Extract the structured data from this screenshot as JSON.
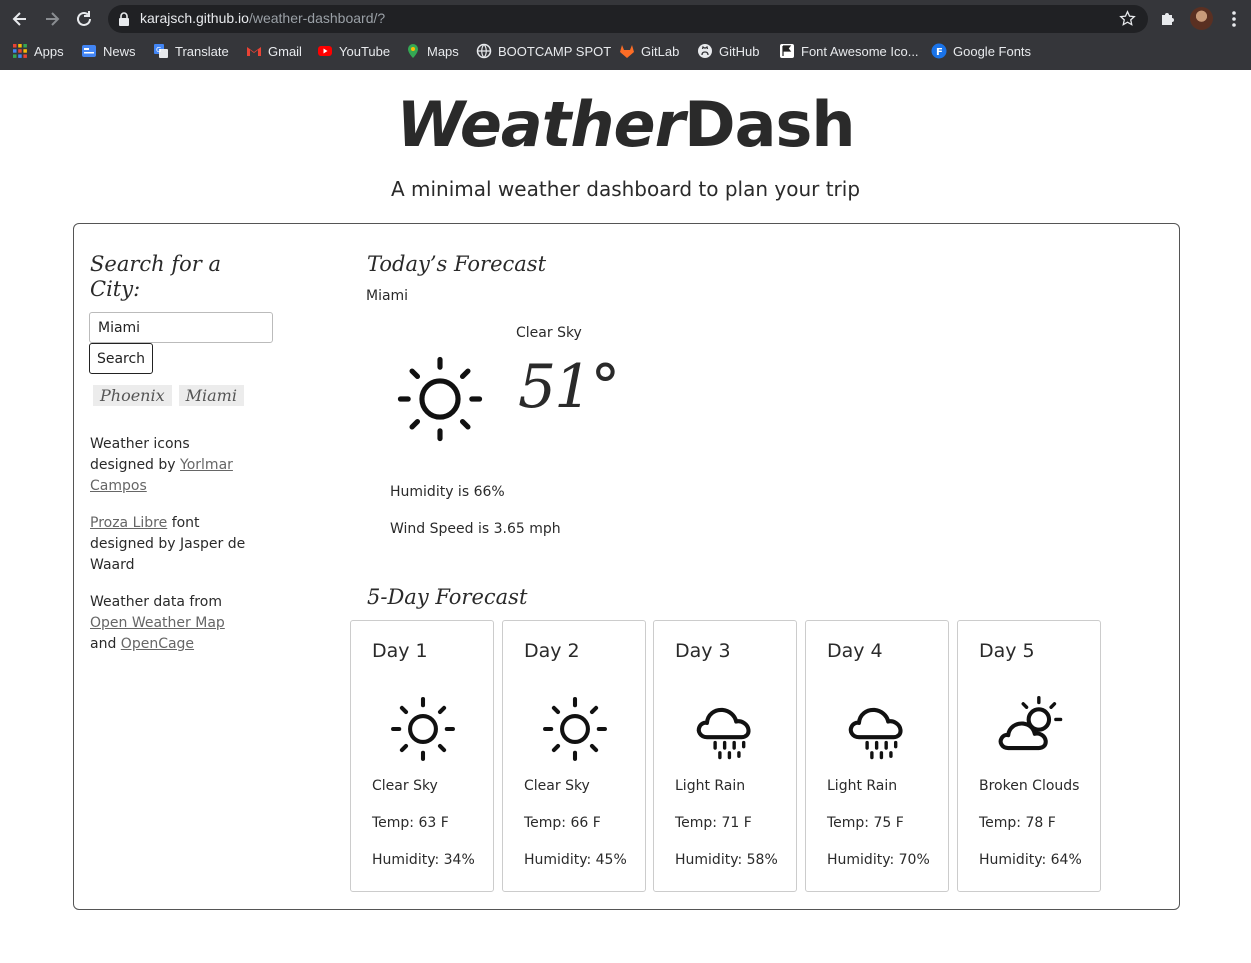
{
  "browser": {
    "url_host": "karajsch.github.io",
    "url_path": "/weather-dashboard/?",
    "bookmarks": [
      {
        "label": "Apps",
        "icon": "apps-grid-icon"
      },
      {
        "label": "News",
        "icon": "news-icon"
      },
      {
        "label": "Translate",
        "icon": "translate-icon"
      },
      {
        "label": "Gmail",
        "icon": "gmail-icon"
      },
      {
        "label": "YouTube",
        "icon": "youtube-icon"
      },
      {
        "label": "Maps",
        "icon": "maps-icon"
      },
      {
        "label": "BOOTCAMP SPOT",
        "icon": "globe-icon"
      },
      {
        "label": "GitLab",
        "icon": "gitlab-icon"
      },
      {
        "label": "GitHub",
        "icon": "github-icon"
      },
      {
        "label": "Font Awesome Ico...",
        "icon": "flag-icon"
      },
      {
        "label": "Google Fonts",
        "icon": "google-fonts-icon"
      }
    ]
  },
  "header": {
    "title_italic": "Weather",
    "title_regular": "Dash",
    "subtitle": "A minimal weather dashboard to plan your trip"
  },
  "sidebar": {
    "search_heading": "Search for a City:",
    "search_value": "Miami",
    "search_button": "Search",
    "history": [
      "Phoenix",
      "Miami"
    ],
    "credits": {
      "icons_text": "Weather icons designed by",
      "icons_link": "Yorlmar Campos",
      "font_link": "Proza Libre",
      "font_text": "font designed by Jasper de Waard",
      "data_text": "Weather data from",
      "data_link1": "Open Weather Map",
      "data_and": "and",
      "data_link2": "OpenCage"
    }
  },
  "today": {
    "heading": "Today’s Forecast",
    "city": "Miami",
    "condition": "Clear Sky",
    "temperature": "51°",
    "icon": "sun-icon",
    "humidity": "Humidity is 66%",
    "wind": "Wind Speed is 3.65 mph"
  },
  "forecast": {
    "heading": "5-Day Forecast",
    "days": [
      {
        "day": "Day 1",
        "icon": "sun-icon",
        "desc": "Clear Sky",
        "temp": "Temp: 63 F",
        "humidity": "Humidity: 34%"
      },
      {
        "day": "Day 2",
        "icon": "sun-icon",
        "desc": "Clear Sky",
        "temp": "Temp: 66 F",
        "humidity": "Humidity: 45%"
      },
      {
        "day": "Day 3",
        "icon": "rain-cloud-icon",
        "desc": "Light Rain",
        "temp": "Temp: 71 F",
        "humidity": "Humidity: 58%"
      },
      {
        "day": "Day 4",
        "icon": "rain-cloud-icon",
        "desc": "Light Rain",
        "temp": "Temp: 75 F",
        "humidity": "Humidity: 70%"
      },
      {
        "day": "Day 5",
        "icon": "cloud-sun-icon",
        "desc": "Broken Clouds",
        "temp": "Temp: 78 F",
        "humidity": "Humidity: 64%"
      }
    ]
  },
  "colors": {
    "chrome_bg": "#35363a",
    "omnibox_bg": "#202124",
    "text": "#2a2a2a",
    "link": "#666666"
  }
}
